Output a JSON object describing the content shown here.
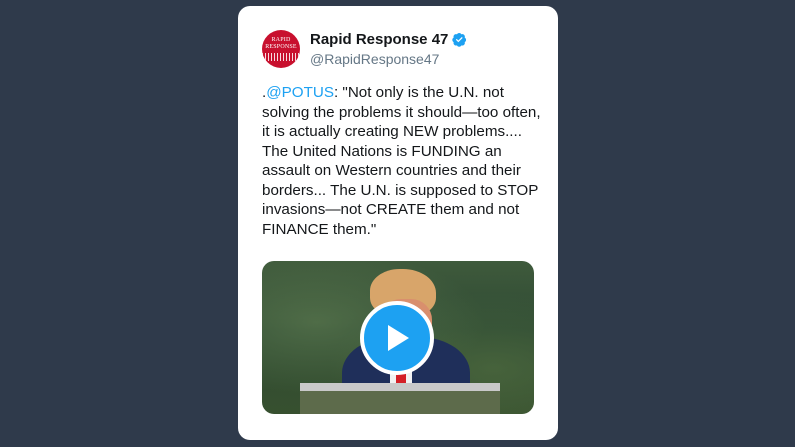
{
  "tweet": {
    "display_name": "Rapid Response 47",
    "handle": "@RapidResponse47",
    "avatar_text_line1": "RAPID",
    "avatar_text_line2": "RESPONSE",
    "text_prefix": ".",
    "mention": "@POTUS",
    "text_body": ": \"Not only is the U.N. not solving the problems it should—too often, it is actually creating NEW problems.... The United Nations is FUNDING an assault on Western countries and their borders... The U.N. is supposed to STOP invasions—not CREATE them and not FINANCE them.\"",
    "verified_icon": "verified-badge-icon",
    "media_icon": "play-icon"
  },
  "colors": {
    "background": "#2f3a4b",
    "card": "#ffffff",
    "link": "#1da1f2",
    "verified": "#1da1f2",
    "avatar": "#c8102e"
  }
}
